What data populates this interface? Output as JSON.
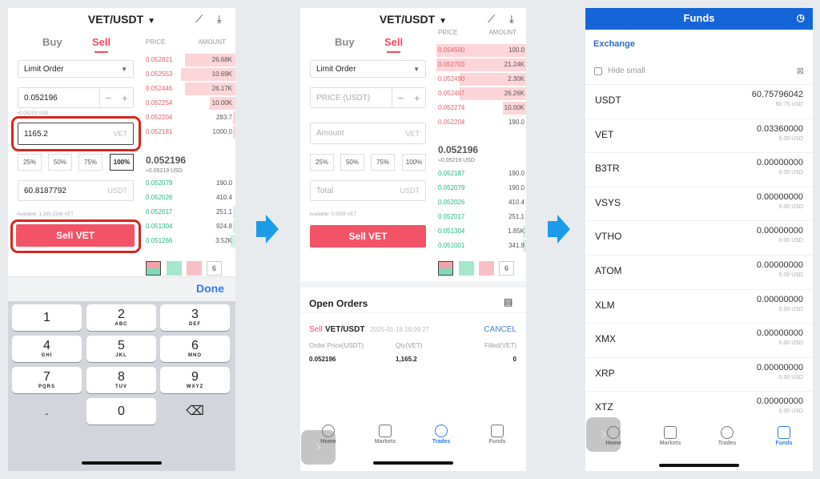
{
  "colors": {
    "sell": "#f25366",
    "ask": "#e0606b",
    "bid": "#22b585",
    "accent": "#2f7bf0",
    "funds_header": "#1565d8",
    "highlight_ring": "#d6261e",
    "arrow": "#1c9be9"
  },
  "screen1": {
    "pair": "VET/USDT",
    "tab_buy": "Buy",
    "tab_sell": "Sell",
    "order_type": "Limit Order",
    "price_value": "0.052196",
    "price_usd": "≈0.05219 USD",
    "amount_value": "1165.2",
    "amount_unit": "VET",
    "percents": [
      "25%",
      "50%",
      "75%",
      "100%"
    ],
    "selected_percent": "100%",
    "total_value": "60.8187792",
    "total_unit": "USDT",
    "available": "Available: 1,165.2336 VET",
    "sell_button": "Sell VET",
    "ob_price_header": "PRICE",
    "ob_amount_header": "AMOUNT",
    "asks": [
      {
        "p": "0.052821",
        "a": "26.68K",
        "d": 0.55
      },
      {
        "p": "0.052553",
        "a": "10.69K",
        "d": 0.6
      },
      {
        "p": "0.052446",
        "a": "26.17K",
        "d": 0.55
      },
      {
        "p": "0.052254",
        "a": "10.00K",
        "d": 0.28
      },
      {
        "p": "0.052204",
        "a": "283.7",
        "d": 0.03
      },
      {
        "p": "0.052181",
        "a": "1000.0",
        "d": 0.03
      }
    ],
    "last_price": "0.052196",
    "last_price_usd": "≈0.05219 USD",
    "bids": [
      {
        "p": "0.052079",
        "a": "190.0",
        "d": 0
      },
      {
        "p": "0.052026",
        "a": "410.4",
        "d": 0
      },
      {
        "p": "0.052017",
        "a": "251.1",
        "d": 0.03
      },
      {
        "p": "0.051304",
        "a": "924.8",
        "d": 0.03
      },
      {
        "p": "0.051266",
        "a": "3.52K",
        "d": 0.05
      }
    ],
    "depth": "6",
    "done": "Done",
    "keys": [
      {
        "d": "1",
        "l": ""
      },
      {
        "d": "2",
        "l": "ABC"
      },
      {
        "d": "3",
        "l": "DEF"
      },
      {
        "d": "4",
        "l": "GHI"
      },
      {
        "d": "5",
        "l": "JKL"
      },
      {
        "d": "6",
        "l": "MNO"
      },
      {
        "d": "7",
        "l": "PQRS"
      },
      {
        "d": "8",
        "l": "TUV"
      },
      {
        "d": "9",
        "l": "WXYZ"
      },
      {
        "d": ".",
        "l": ""
      },
      {
        "d": "0",
        "l": ""
      }
    ]
  },
  "screen2": {
    "pair": "VET/USDT",
    "tab_buy": "Buy",
    "tab_sell": "Sell",
    "order_type": "Limit Order",
    "price_placeholder": "PRICE (USDT)",
    "amount_placeholder": "Amount",
    "amount_unit": "VET",
    "percents": [
      "25%",
      "50%",
      "75%",
      "100%"
    ],
    "total_placeholder": "Total",
    "total_unit": "USDT",
    "available": "Available: 0.0336 VET",
    "sell_button": "Sell VET",
    "ob_price_header": "PRICE",
    "ob_amount_header": "AMOUNT",
    "asks": [
      {
        "p": "0.054500",
        "a": "100.0",
        "d": 1
      },
      {
        "p": "0.052703",
        "a": "21.24K",
        "d": 1
      },
      {
        "p": "0.052490",
        "a": "2.30K",
        "d": 0.75
      },
      {
        "p": "0.052467",
        "a": "26.26K",
        "d": 0.75
      },
      {
        "p": "0.052274",
        "a": "10.00K",
        "d": 0.27
      },
      {
        "p": "0.052204",
        "a": "190.0",
        "d": 0
      }
    ],
    "last_price": "0.052196",
    "last_price_usd": "≈0.05219 USD",
    "bids": [
      {
        "p": "0.052187",
        "a": "190.0",
        "d": 0
      },
      {
        "p": "0.052079",
        "a": "190.0",
        "d": 0
      },
      {
        "p": "0.052026",
        "a": "410.4",
        "d": 0
      },
      {
        "p": "0.052017",
        "a": "251.1",
        "d": 0.03
      },
      {
        "p": "0.051304",
        "a": "1.85K",
        "d": 0.05
      },
      {
        "p": "0.051001",
        "a": "341.9",
        "d": 0.05
      }
    ],
    "depth": "6",
    "open_orders": {
      "title": "Open Orders",
      "side": "Sell",
      "pair": "VET/USDT",
      "time": "2025-01-18 19:09:27",
      "cancel": "CANCEL",
      "col_price": "Order Price(USDT)",
      "col_qty": "Qty(VET)",
      "col_filled": "Filled(VET)",
      "price": "0.052196",
      "qty": "1,165.2",
      "filled": "0"
    },
    "nav": [
      "Home",
      "Markets",
      "Trades",
      "Funds"
    ],
    "active_nav": "Trades"
  },
  "screen3": {
    "title": "Funds",
    "section": "Exchange",
    "hide_small": "Hide small",
    "assets": [
      {
        "n": "USDT",
        "v": "60.75796042",
        "u": "60.75 USD"
      },
      {
        "n": "VET",
        "v": "0.03360000",
        "u": "0.00 USD"
      },
      {
        "n": "B3TR",
        "v": "0.00000000",
        "u": "0.00 USD"
      },
      {
        "n": "VSYS",
        "v": "0.00000000",
        "u": "0.00 USD"
      },
      {
        "n": "VTHO",
        "v": "0.00000000",
        "u": "0.00 USD"
      },
      {
        "n": "ATOM",
        "v": "0.00000000",
        "u": "0.00 USD"
      },
      {
        "n": "XLM",
        "v": "0.00000000",
        "u": "0.00 USD"
      },
      {
        "n": "XMX",
        "v": "0.00000000",
        "u": "0.00 USD"
      },
      {
        "n": "XRP",
        "v": "0.00000000",
        "u": "0.00 USD"
      },
      {
        "n": "XTZ",
        "v": "0.00000000",
        "u": "0.00 USD"
      }
    ],
    "nav": [
      "Home",
      "Markets",
      "Trades",
      "Funds"
    ],
    "active_nav": "Funds"
  }
}
